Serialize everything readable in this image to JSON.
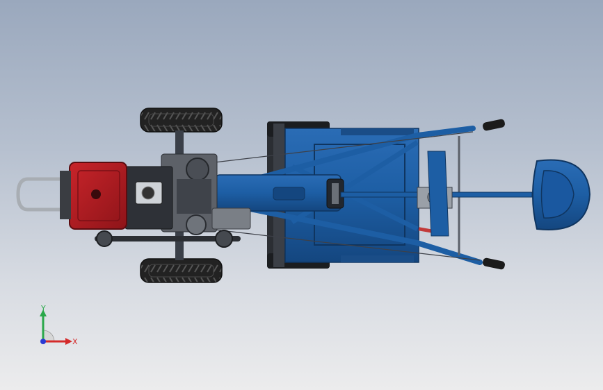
{
  "viewport": {
    "background_top": "#9aa8bd",
    "background_bottom": "#ececed",
    "body_color": "#1f5fa6",
    "body_dark": "#14457d",
    "engine_color": "#b01c22",
    "tire_color": "#2a2a2a"
  },
  "triad": {
    "x_label": "X",
    "y_label": "Y",
    "x_color": "#d42a2a",
    "y_color": "#2aa84a",
    "z_color": "#2a3ad4"
  }
}
